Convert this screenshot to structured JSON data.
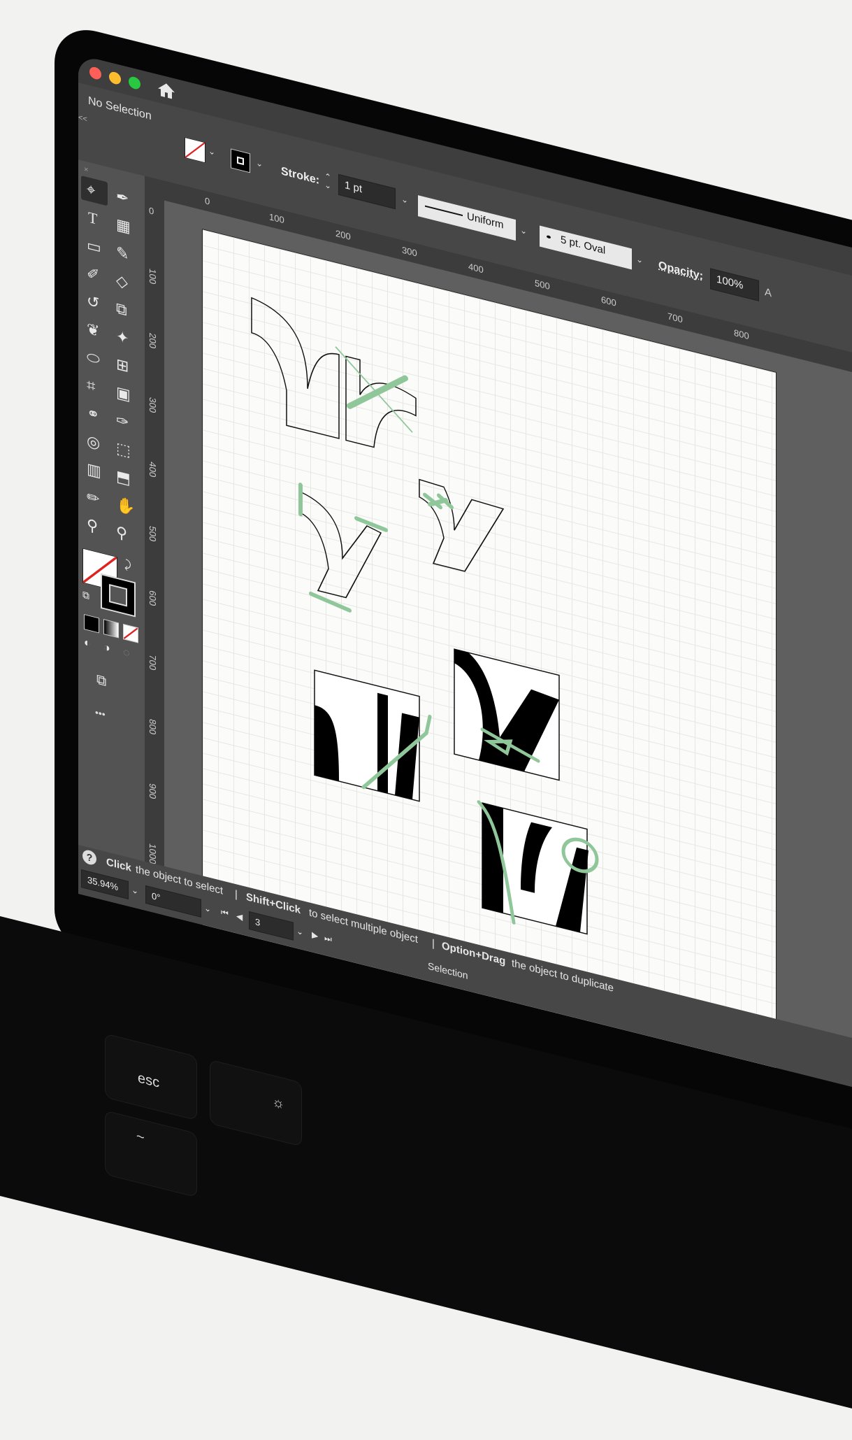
{
  "app": {
    "selection_status": "No Selection",
    "collapse_label": "<<",
    "close_label": "×"
  },
  "control_bar": {
    "stroke_label": "Stroke:",
    "stroke_weight": "1 pt",
    "stroke_profile": "Uniform",
    "brush": "5 pt. Oval",
    "opacity_label": "Opacity:",
    "opacity_value": "100%",
    "truncated_label": "A"
  },
  "ruler_h": [
    "0",
    "100",
    "200",
    "300",
    "400",
    "500",
    "600",
    "700",
    "800"
  ],
  "ruler_v": [
    "0",
    "100",
    "200",
    "300",
    "400",
    "500",
    "600",
    "700",
    "800",
    "900",
    "1000"
  ],
  "statusbar": {
    "help_icon": "?",
    "hint_click_key": "Click",
    "hint_click_text": "the object to select",
    "hint_shift_key": "Shift+Click",
    "hint_shift_text": "to select multiple object",
    "hint_option_key": "Option+Drag",
    "hint_option_text": "the object to duplicate",
    "separator": "|",
    "zoom": "35.94%",
    "rotation": "0°",
    "artboard_number": "3",
    "tool_name": "Selection"
  },
  "keyboard": {
    "esc": "esc",
    "brightness_icon": "☼",
    "tilde": "~"
  },
  "icons": {
    "home": "home-icon",
    "more": "•••"
  },
  "colors": {
    "accent_green": "#8fc79a",
    "app_bg": "#535353",
    "artboard": "#fbfbf9"
  }
}
